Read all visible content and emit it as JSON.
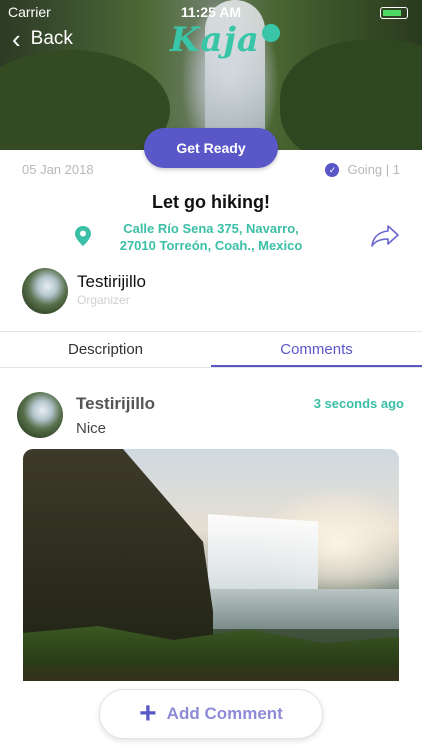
{
  "status_bar": {
    "carrier": "Carrier",
    "time": "11:25 AM"
  },
  "nav": {
    "back_label": "Back",
    "logo_text": "Kaja"
  },
  "event": {
    "cta_label": "Get Ready",
    "date": "05 Jan 2018",
    "going_label": "Going | 1",
    "title": "Let go hiking!",
    "address_line1": "Calle Río Sena 375, Navarro,",
    "address_line2": "27010 Torreón, Coah., Mexico"
  },
  "organizer": {
    "name": "Testirijillo",
    "role": "Organizer"
  },
  "tabs": [
    {
      "label": "Description",
      "active": false
    },
    {
      "label": "Comments",
      "active": true
    }
  ],
  "comments": [
    {
      "author": "Testirijillo",
      "time": "3 seconds ago",
      "text": "Nice",
      "has_photo": true
    }
  ],
  "add_comment_label": "Add Comment",
  "colors": {
    "accent": "#5a57c8",
    "teal": "#3bbfa6",
    "muted": "#b8b8b8"
  },
  "icons": [
    "back-chevron-icon",
    "check-circle-icon",
    "location-pin-icon",
    "share-arrow-icon",
    "plus-icon"
  ]
}
